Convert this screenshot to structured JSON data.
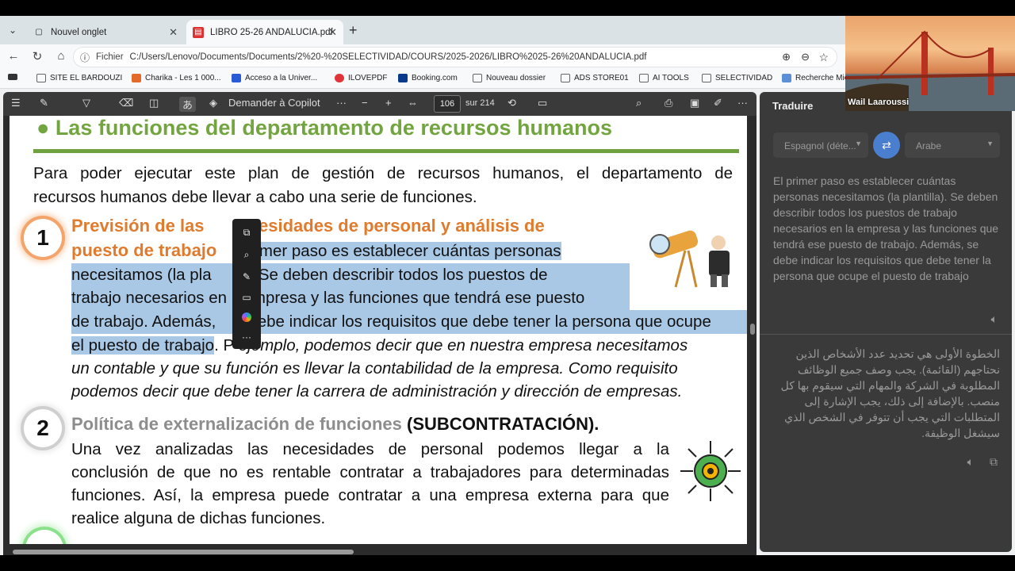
{
  "browser": {
    "tabs": [
      {
        "label": "Nouvel onglet",
        "icon": "page-icon"
      },
      {
        "label": "LIBRO 25-26 ANDALUCIA.pdf",
        "icon": "pdf-icon"
      }
    ],
    "url_label": "Fichier",
    "url": "C:/Users/Lenovo/Documents/Documents/2%20-%20SELECTIVIDAD/COURS/2025-2026/LIBRO%2025-26%20ANDALUCIA.pdf",
    "bookmarks": [
      "SITE EL BARDOUZI",
      "Charika - Les 1 000...",
      "Acceso a la Univer...",
      "ILOVEPDF",
      "Booking.com",
      "Nouveau dossier",
      "ADS STORE01",
      "AI TOOLS",
      "SELECTIVIDAD",
      "Recherche Mic"
    ]
  },
  "pdf_toolbar": {
    "copilot": "Demander à Copilot",
    "page": "106",
    "total": "sur 214"
  },
  "page": {
    "heading": "Las funciones del departamento de recursos humanos",
    "intro_l1": "Para poder ejecutar este plan de gestión de recursos humanos, el departamento de",
    "intro_l2": "recursos humanos debe llevar a cabo una serie de funciones.",
    "n1": "1",
    "t1_l1a": "Previsión de las",
    "t1_l1b": "ecesidades de personal y análisis de",
    "t1_l2a": "puesto de trabajo",
    "t1_l2b": "l primer paso es establecer cuántas personas",
    "t1_l3a": "necesitamos (la pla",
    "t1_l3b": "). Se deben describir todos los puestos de",
    "t1_l4a": "trabajo necesarios en",
    "t1_l4b": "empresa y las funciones que tendrá ese puesto",
    "t1_l5a": "de trabajo. Además,",
    "t1_l5b": "debe indicar los requisitos que debe tener la persona que ocupe",
    "t1_l6a": "el puesto de trabajo",
    "t1_l6b": ". P",
    "t1_l6c": " ejemplo, podemos decir que en nuestra empresa necesitamos",
    "t1_l7": "un contable y que su función es llevar la contabilidad de la empresa. Como requisito",
    "t1_l8": "podemos decir que debe tener la carrera de administración y dirección de empresas.",
    "n2": "2",
    "t2_title": "Política de externalización de funciones",
    "t2_tag": "(SUBCONTRATACIÓN).",
    "t2_l1": "Una vez analizadas las necesidades de personal podemos llegar a la",
    "t2_l2": "conclusión de que no es rentable contratar a trabajadores para determinadas",
    "t2_l3": "funciones. Así, la empresa puede contratar a una empresa externa para que",
    "t2_l4": "realice alguna de dichas funciones."
  },
  "translate": {
    "title": "Traduire",
    "from": "Espagnol (déte...",
    "to": "Arabe",
    "source": "El primer paso es establecer cuántas personas necesitamos (la plantilla). Se deben describir todos los puestos de trabajo necesarios en la empresa y las funciones que tendrá ese puesto de trabajo. Además, se debe indicar los requisitos que debe tener la persona que ocupe el puesto de trabajo",
    "target": "الخطوة الأولى هي تحديد عدد الأشخاص الذين نحتاجهم (القائمة). يجب وصف جميع الوظائف المطلوبة في الشركة والمهام التي سيقوم بها كل منصب. بالإضافة إلى ذلك، يجب الإشارة إلى المتطلبات التي يجب أن تتوفر في الشخص الذي سيشغل الوظيفة."
  },
  "webcam": {
    "name": "Wail Laaroussi"
  },
  "colors": {
    "heading_green": "#72a53f",
    "orange": "#e07b2e",
    "highlight": "#a9c8e6"
  }
}
